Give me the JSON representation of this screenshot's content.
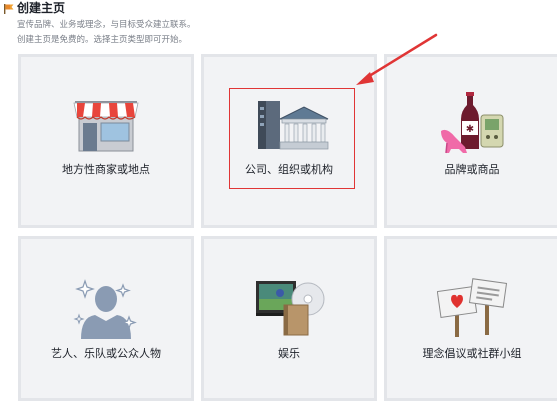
{
  "header": {
    "title": "创建主页",
    "desc_line1": "宣传品牌、业务或理念，与目标受众建立联系。",
    "desc_line2": "创建主页是免费的。选择主页类型即可开始。"
  },
  "categories": [
    {
      "label": "地方性商家或地点"
    },
    {
      "label": "公司、组织或机构"
    },
    {
      "label": "品牌或商品"
    },
    {
      "label": "艺人、乐队或公众人物"
    },
    {
      "label": "娱乐"
    },
    {
      "label": "理念倡议或社群小组"
    }
  ],
  "colors": {
    "card_bg": "#f2f3f5",
    "card_border": "#e3e5e9",
    "highlight": "#e03535"
  }
}
